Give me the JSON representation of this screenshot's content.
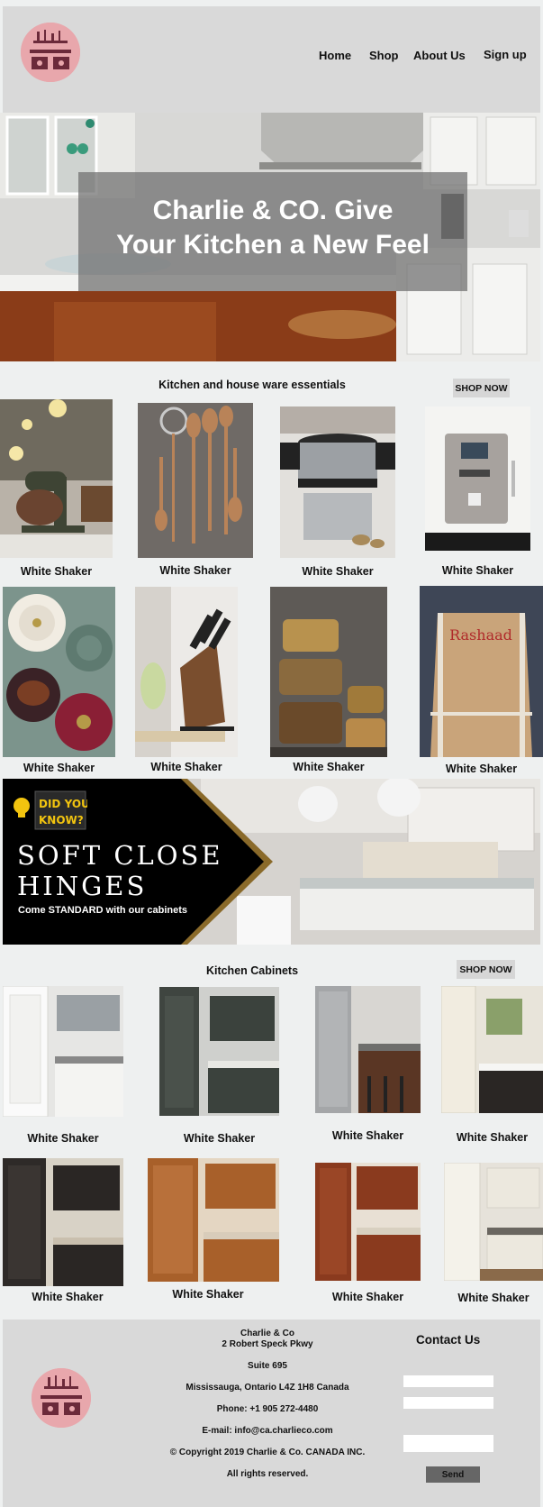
{
  "header": {
    "logo_icon": "kitchen-logo-icon",
    "nav": [
      "Home",
      "Shop",
      "About Us",
      "Sign up"
    ]
  },
  "hero": {
    "title_line1": "Charlie & CO. Give",
    "title_line2": "Your Kitchen a New Feel"
  },
  "essentials": {
    "title": "Kitchen and house ware essentials",
    "shop_label": "SHOP NOW",
    "products": [
      {
        "caption": "White Shaker",
        "icon": "stand-mixer-image"
      },
      {
        "caption": "White Shaker",
        "icon": "wooden-utensils-image"
      },
      {
        "caption": "White Shaker",
        "icon": "steamer-pot-image"
      },
      {
        "caption": "White Shaker",
        "icon": "espresso-machine-image"
      },
      {
        "caption": "White Shaker",
        "icon": "cast-iron-pots-image"
      },
      {
        "caption": "White Shaker",
        "icon": "knife-block-image"
      },
      {
        "caption": "White Shaker",
        "icon": "glass-jars-image"
      },
      {
        "caption": "White Shaker",
        "icon": "apron-image"
      }
    ],
    "apron_text": "Rashaad"
  },
  "promo": {
    "badge_line1": "DID YOU",
    "badge_line2": "KNOW?",
    "title": "SOFT CLOSE\nHINGES",
    "subtitle": "Come STANDARD with our cabinets"
  },
  "cabinets": {
    "title": "Kitchen  Cabinets",
    "shop_label": "SHOP NOW",
    "products": [
      {
        "caption": "White Shaker",
        "icon": "white-cabinet-image"
      },
      {
        "caption": "White Shaker",
        "icon": "charcoal-cabinet-image"
      },
      {
        "caption": "White Shaker",
        "icon": "grey-wood-cabinet-image"
      },
      {
        "caption": "White Shaker",
        "icon": "cream-cabinet-image"
      },
      {
        "caption": "White Shaker",
        "icon": "espresso-cabinet-image"
      },
      {
        "caption": "White Shaker",
        "icon": "honey-oak-cabinet-image"
      },
      {
        "caption": "White Shaker",
        "icon": "cherry-cabinet-image"
      },
      {
        "caption": "White Shaker",
        "icon": "antique-white-cabinet-image"
      }
    ]
  },
  "footer": {
    "company": "Charlie & Co",
    "address1": "2 Robert Speck Pkwy",
    "suite": "Suite 695",
    "city": "Mississauga, Ontario L4Z 1H8 Canada",
    "phone": "Phone: +1 905 272-4480",
    "email": "E-mail: info@ca.charlieco.com",
    "copyright": "© Copyright 2019 Charlie & Co. CANADA INC.",
    "rights": "All rights reserved.",
    "contact_title": "Contact Us",
    "send_label": "Send"
  },
  "colors": {
    "header_bg": "#d9d9d9",
    "page_bg": "#eef0f0",
    "logo_pink": "#e8a7ac",
    "logo_maroon": "#6b2a3a",
    "promo_gold": "#8a6a2a",
    "badge_yellow": "#f2c40f"
  }
}
